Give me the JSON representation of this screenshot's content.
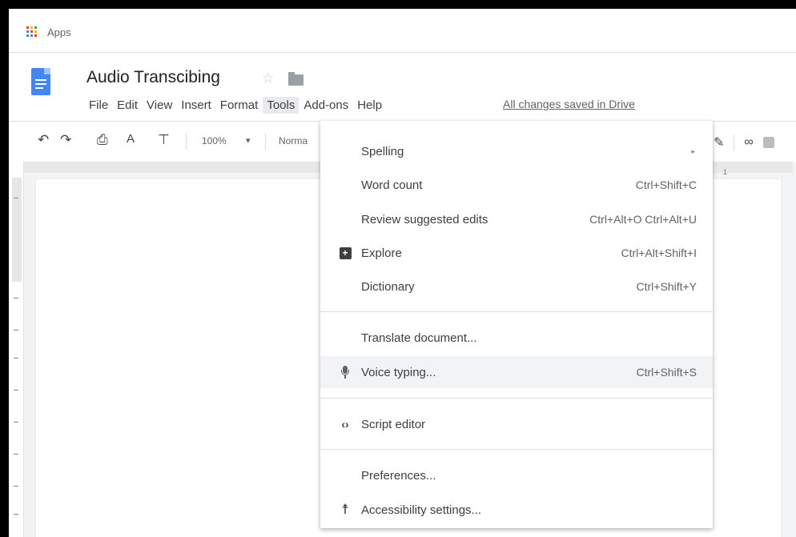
{
  "apps_bar": {
    "label": "Apps"
  },
  "document": {
    "title": "Audio Transcibing",
    "save_status": "All changes saved in Drive"
  },
  "menubar": [
    {
      "label": "File"
    },
    {
      "label": "Edit"
    },
    {
      "label": "View"
    },
    {
      "label": "Insert"
    },
    {
      "label": "Format"
    },
    {
      "label": "Tools",
      "active": true
    },
    {
      "label": "Add-ons"
    },
    {
      "label": "Help"
    }
  ],
  "toolbar": {
    "zoom": "100%",
    "zoom_caret": "▾",
    "style": "Norma"
  },
  "ruler": {
    "right_number": "1"
  },
  "tools_menu": {
    "items": [
      {
        "label": "Spelling",
        "shortcut": "",
        "submenu": "▸",
        "icon": ""
      },
      {
        "label": "Word count",
        "shortcut": "Ctrl+Shift+C",
        "icon": ""
      },
      {
        "label": "Review suggested edits",
        "shortcut": "Ctrl+Alt+O Ctrl+Alt+U",
        "icon": ""
      },
      {
        "label": "Explore",
        "shortcut": "Ctrl+Alt+Shift+I",
        "icon": "explore-icon"
      },
      {
        "label": "Dictionary",
        "shortcut": "Ctrl+Shift+Y",
        "icon": ""
      },
      {
        "label": "Translate document...",
        "shortcut": "",
        "icon": ""
      },
      {
        "label": "Voice typing...",
        "shortcut": "Ctrl+Shift+S",
        "icon": "microphone-icon",
        "highlighted": true
      },
      {
        "label": "Script editor",
        "shortcut": "",
        "icon": "code-icon"
      },
      {
        "label": "Preferences...",
        "shortcut": "",
        "icon": ""
      },
      {
        "label": "Accessibility settings...",
        "shortcut": "",
        "icon": "accessibility-icon"
      }
    ]
  },
  "colors": {
    "docs_blue": "#4285f4",
    "menu_highlight": "#f1f3f4",
    "text": "#3c4043"
  }
}
